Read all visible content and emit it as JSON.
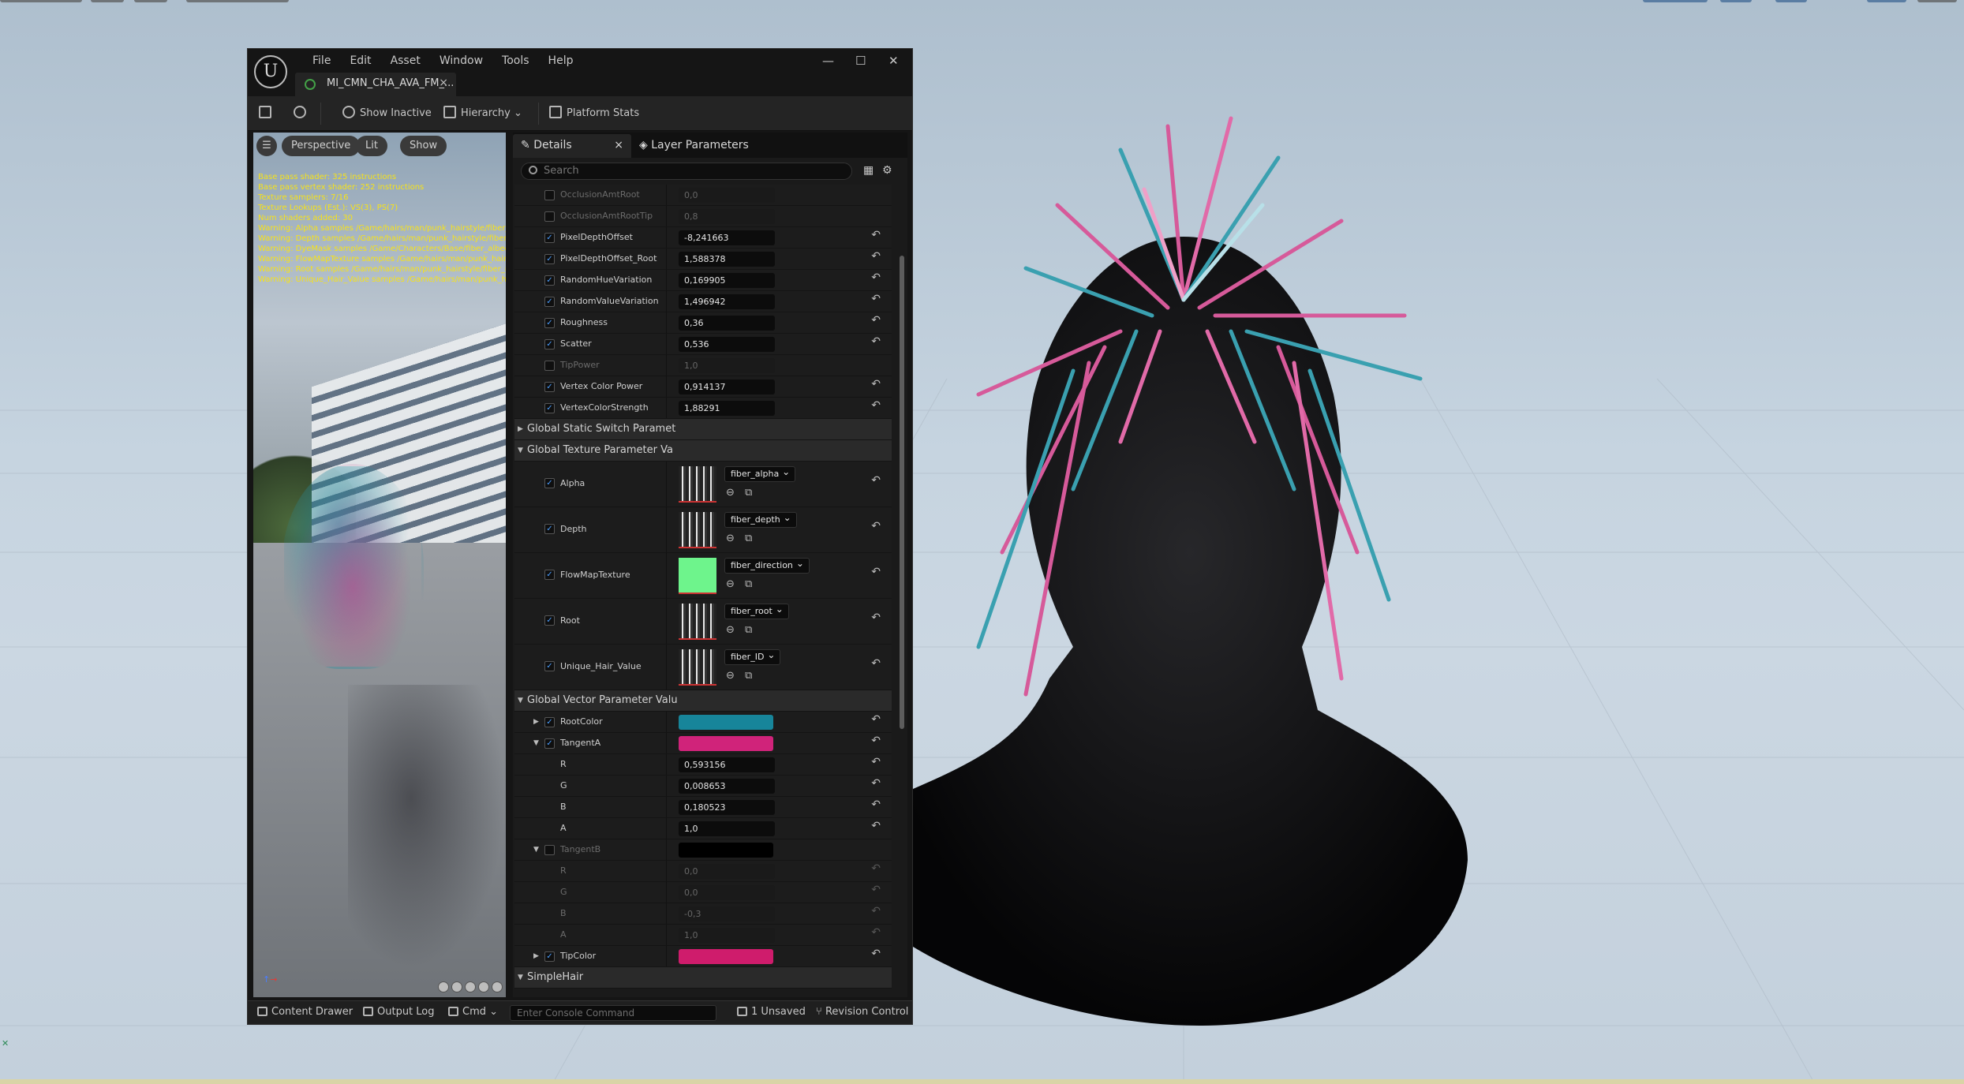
{
  "app": {
    "menu": [
      "File",
      "Edit",
      "Asset",
      "Window",
      "Tools",
      "Help"
    ],
    "doc_tab": "MI_CMN_CHA_AVA_FM_...",
    "window_controls": {
      "minimize": "—",
      "maximize": "☐",
      "close": "✕"
    }
  },
  "toolbar": {
    "show_inactive": "Show Inactive",
    "hierarchy": "Hierarchy",
    "platform_stats": "Platform Stats"
  },
  "viewport": {
    "perspective": "Perspective",
    "lit": "Lit",
    "show": "Show",
    "stats": [
      "Base pass shader: 325 instructions",
      "Base pass vertex shader: 252 instructions",
      "Texture samplers: 7/16",
      "Texture Lookups (Est.): VS(3), PS(7)",
      "Num shaders added: 30",
      "Warning: Alpha samples /Game/hairs/man/punk_hairstyle/fiber_alpha",
      "Warning: Depth samples /Game/hairs/man/punk_hairstyle/fiber_depth",
      "Warning: DyeMask samples /Game/Characters/Base/fiber_albedo",
      "Warning: FlowMapTexture samples /Game/hairs/man/punk_hairstyle/fiber",
      "Warning: Root samples /Game/hairs/man/punk_hairstyle/fiber_root",
      "Warning: Unique_Hair_Value samples /Game/hairs/man/punk_hairstyle/fiber_ID"
    ]
  },
  "details": {
    "tab_details": "Details",
    "tab_close": "×",
    "tab_layer": "Layer Parameters",
    "search_placeholder": "Search",
    "scalar_rows": [
      {
        "name": "OcclusionAmtRoot",
        "value": "0,0",
        "enabled": false,
        "checked": false,
        "reset": false
      },
      {
        "name": "OcclusionAmtRootTip",
        "value": "0,8",
        "enabled": false,
        "checked": false,
        "reset": false
      },
      {
        "name": "PixelDepthOffset",
        "value": "-8,241663",
        "enabled": true,
        "checked": true,
        "reset": true
      },
      {
        "name": "PixelDepthOffset_Root",
        "value": "1,588378",
        "enabled": true,
        "checked": true,
        "reset": true
      },
      {
        "name": "RandomHueVariation",
        "value": "0,169905",
        "enabled": true,
        "checked": true,
        "reset": true
      },
      {
        "name": "RandomValueVariation",
        "value": "1,496942",
        "enabled": true,
        "checked": true,
        "reset": true
      },
      {
        "name": "Roughness",
        "value": "0,36",
        "enabled": true,
        "checked": true,
        "reset": true
      },
      {
        "name": "Scatter",
        "value": "0,536",
        "enabled": true,
        "checked": true,
        "reset": true
      },
      {
        "name": "TipPower",
        "value": "1,0",
        "enabled": false,
        "checked": false,
        "reset": false
      },
      {
        "name": "Vertex Color Power",
        "value": "0,914137",
        "enabled": true,
        "checked": true,
        "reset": true
      },
      {
        "name": "VertexColorStrength",
        "value": "1,88291",
        "enabled": true,
        "checked": true,
        "reset": true
      }
    ],
    "cat_static_switch": "Global Static Switch Paramet",
    "cat_texture": "Global Texture Parameter Va",
    "texture_rows": [
      {
        "name": "Alpha",
        "asset": "fiber_alpha",
        "green": false
      },
      {
        "name": "Depth",
        "asset": "fiber_depth",
        "green": false
      },
      {
        "name": "FlowMapTexture",
        "asset": "fiber_direction",
        "green": true
      },
      {
        "name": "Root",
        "asset": "fiber_root",
        "green": false
      },
      {
        "name": "Unique_Hair_Value",
        "asset": "fiber_ID",
        "green": false
      }
    ],
    "cat_vector": "Global Vector Parameter Valu",
    "vector_rows": [
      {
        "name": "RootColor",
        "color": "#17859a",
        "checked": true,
        "expanded": false,
        "enabled": true,
        "reset": true
      },
      {
        "name": "TangentA",
        "color": "#d0237a",
        "checked": true,
        "expanded": true,
        "enabled": true,
        "reset": true,
        "channels": [
          {
            "c": "R",
            "v": "0,593156"
          },
          {
            "c": "G",
            "v": "0,008653"
          },
          {
            "c": "B",
            "v": "0,180523"
          },
          {
            "c": "A",
            "v": "1,0"
          }
        ]
      },
      {
        "name": "TangentB",
        "color": "#000000",
        "checked": false,
        "expanded": true,
        "enabled": false,
        "reset": false,
        "channels": [
          {
            "c": "R",
            "v": "0,0"
          },
          {
            "c": "G",
            "v": "0,0"
          },
          {
            "c": "B",
            "v": "-0,3"
          },
          {
            "c": "A",
            "v": "1,0"
          }
        ]
      },
      {
        "name": "TipColor",
        "color": "#cf1c6c",
        "checked": true,
        "expanded": false,
        "enabled": true,
        "reset": true
      }
    ],
    "cat_simplehair": "SimpleHair"
  },
  "statusbar": {
    "content_drawer": "Content Drawer",
    "output_log": "Output Log",
    "cmd": "Cmd",
    "console_placeholder": "Enter Console Command",
    "unsaved": "1 Unsaved",
    "revision": "Revision Control"
  },
  "colors": {
    "accent_blue": "#4a9eff",
    "hair_pink": "#d0237a",
    "hair_teal": "#17859a",
    "stats_yellow": "#f6e21a"
  },
  "icons": [
    "unreal-logo-icon",
    "save-icon",
    "browse-icon",
    "show-inactive-icon",
    "hierarchy-icon",
    "platform-stats-icon",
    "pencil-icon",
    "layers-icon",
    "search-icon",
    "grid-view-icon",
    "gear-icon",
    "reset-arrow-icon",
    "use-selected-icon",
    "browse-asset-icon"
  ]
}
